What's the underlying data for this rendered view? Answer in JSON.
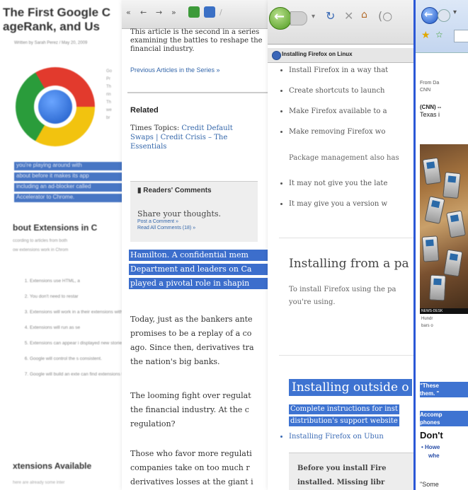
{
  "panel_chrome_blog": {
    "title_line1": "The First Google C",
    "title_line2": "ageRank, and Us",
    "meta": "Written by Sarah Perez / May 20, 2009",
    "side_text": "Go\nPr\nTh\nrin\nTh\nwe\nbr",
    "highlight_lines": [
      "you're playing around with",
      "about before it makes its app",
      "including an ad-blocker called",
      "",
      " Accelerator to Chrome."
    ],
    "section_heading": "bout Extensions in C",
    "intro_line1": "ccording to articles from both",
    "intro_line2": "ow extensions work in Chrom",
    "list_items": [
      "Extensions use HTML, a",
      "You don't need to restar",
      "Extensions will work in a their extensions with ea",
      "Extensions will run as se",
      "Extensions can appear i displayed new stories fr",
      "Google will control the s consistent.",
      "Google will build an exte can find extensions to in"
    ],
    "section_heading2": "xtensions Available",
    "tail": "here are already some inter"
  },
  "panel_times": {
    "toolbar": {
      "first": "«",
      "prev": "←",
      "next": "→",
      "last": "»"
    },
    "intro": "This article is the second in a series examining the battles to reshape the financial industry.",
    "prev_articles": "Previous Articles in the Series »",
    "related": "Related",
    "topics_prefix": "Times Topics: ",
    "topics_link": "Credit Default Swaps | Credit Crisis – The Essentials",
    "readers_comments": "Readers' Comments",
    "share": "Share your thoughts.",
    "post_comment": "Post a Comment »",
    "read_comments": "Read All Comments (18) »",
    "selected_lines": [
      "Hamilton. A confidential mem",
      "Department and leaders on Ca",
      "played a pivotal role in shapin"
    ],
    "para1": [
      "Today, just as the bankers ante",
      "promises to be a replay of a co",
      "ago. Since then, derivatives tra",
      "the nation's big banks."
    ],
    "para2": [
      "The looming fight over regulat",
      "the financial industry. At the c",
      "regulation?"
    ],
    "para3": [
      "Those who favor more regulati",
      "companies take on too much r",
      "derivatives losses at the giant i"
    ]
  },
  "panel_firefox": {
    "tab_label": "Installing Firefox on Linux",
    "bullets_top": [
      "Install Firefox in a way that",
      "Create shortcuts to launch",
      "Make Firefox available to a",
      "Make removing Firefox wo"
    ],
    "pkg_text": "Package management also has",
    "bullets_mid": [
      "It may not give you the late",
      "It may give you a version w"
    ],
    "heading_pkg": "Installing from a pa",
    "pkg_line1": "To install Firefox using the pa",
    "pkg_line2": "you're using.",
    "heading_outside": "Installing outside o",
    "complete_line1": "Complete instructions for inst",
    "complete_line2": "distribution's support website",
    "ubuntu_link": "Installing Firefox on Ubun",
    "box_line1": "Before you install Fire",
    "box_line2": "installed. Missing libr"
  },
  "panel_ie": {
    "src1": "From Da",
    "src2": "CNN",
    "lead1": "(CNN) --",
    "lead2": "Texas i",
    "caption_bar": "NEWS-DESK",
    "cap1": "Hundr",
    "cap2": "bars o",
    "quote1": "\"These",
    "quote2": "them. \"",
    "accomp1": "Accomp",
    "accomp2": "phones",
    "dont": "Don't",
    "bul1": "• Howe",
    "bul2": "whe",
    "some": "\"Some"
  },
  "colors": {
    "selection_blue": "#3c6ecc",
    "ie_border_blue": "#2b58d6",
    "link_blue": "#3366aa"
  }
}
